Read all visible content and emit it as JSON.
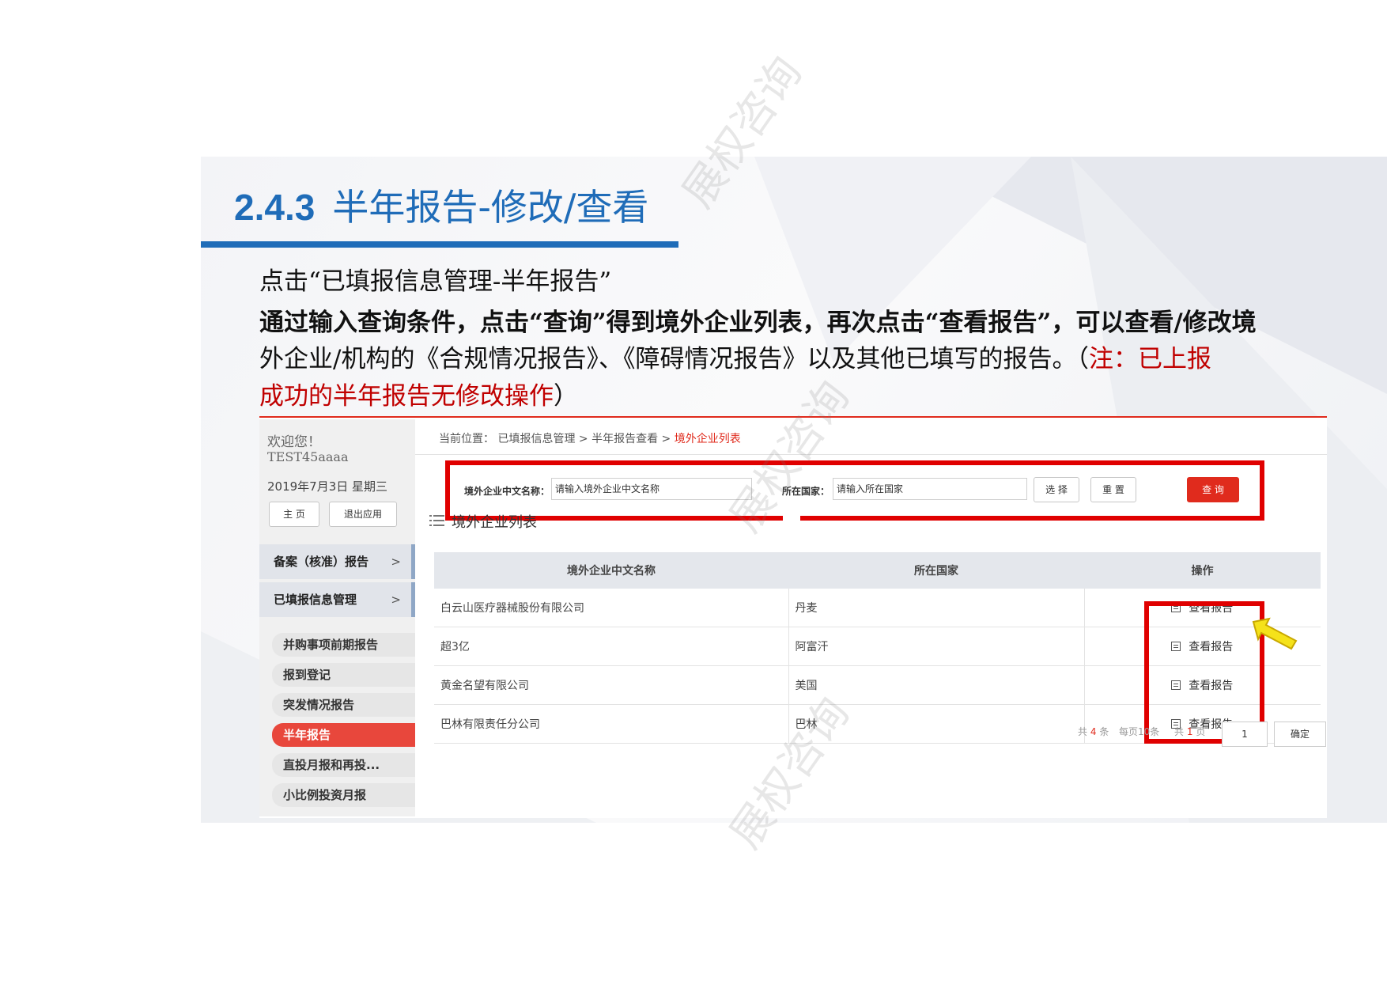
{
  "slide": {
    "title_number": "2.4.3",
    "title_text": "半年报告-修改/查看",
    "line1": "点击“已填报信息管理-半年报告”",
    "line2": "通过输入查询条件，点击“查询”得到境外企业列表，再次点击“查看报告”，可以查看/修改境",
    "line3_black": "外企业/机构的《合规情况报告》、《障碍情况报告》以及其他已填写的报告。（",
    "line3_red": "注：已上报",
    "line4_red": "成功的半年报告无修改操作",
    "line4_black": "）",
    "accent_color": "#1f6cb8",
    "note_color": "#c00000"
  },
  "sidebar": {
    "welcome": "欢迎您！",
    "user": "TEST45aaaa",
    "date": "2019年7月3日 星期三",
    "home_btn": "主 页",
    "logout_btn": "退出应用",
    "menu1": "备案（核准）报告",
    "menu2": "已填报信息管理",
    "arrow": ">",
    "subitems": [
      "并购事项前期报告",
      "报到登记",
      "突发情况报告",
      "半年报告",
      "直投月报和再投...",
      "小比例投资月报"
    ]
  },
  "breadcrumb": {
    "prefix": "当前位置：",
    "level1": "已填报信息管理",
    "sep": ">",
    "level2": "半年报告查看",
    "current": "境外企业列表"
  },
  "query": {
    "name_label": "境外企业中文名称：",
    "name_placeholder": "请输入境外企业中文名称",
    "country_label": "所在国家：",
    "country_placeholder": "请输入所在国家",
    "select_btn": "选 择",
    "reset_btn": "重 置",
    "search_btn": "查 询"
  },
  "list": {
    "title": "境外企业列表",
    "columns": [
      "境外企业中文名称",
      "所在国家",
      "操作"
    ],
    "rows": [
      {
        "name": "白云山医疗器械股份有限公司",
        "country": "丹麦",
        "op": "查看报告"
      },
      {
        "name": "超3亿",
        "country": "阿富汗",
        "op": "查看报告"
      },
      {
        "name": "黄金名望有限公司",
        "country": "美国",
        "op": "查看报告"
      },
      {
        "name": "巴林有限责任分公司",
        "country": "巴林",
        "op": "查看报告"
      }
    ]
  },
  "pager": {
    "total_prefix": "共",
    "total_count": "4",
    "total_suffix": "条",
    "per_page": "每页10条",
    "pages_prefix": "共",
    "pages_count": "1",
    "pages_suffix": "页",
    "page_value": "1",
    "confirm": "确定"
  },
  "watermark_text": "展权咨询"
}
